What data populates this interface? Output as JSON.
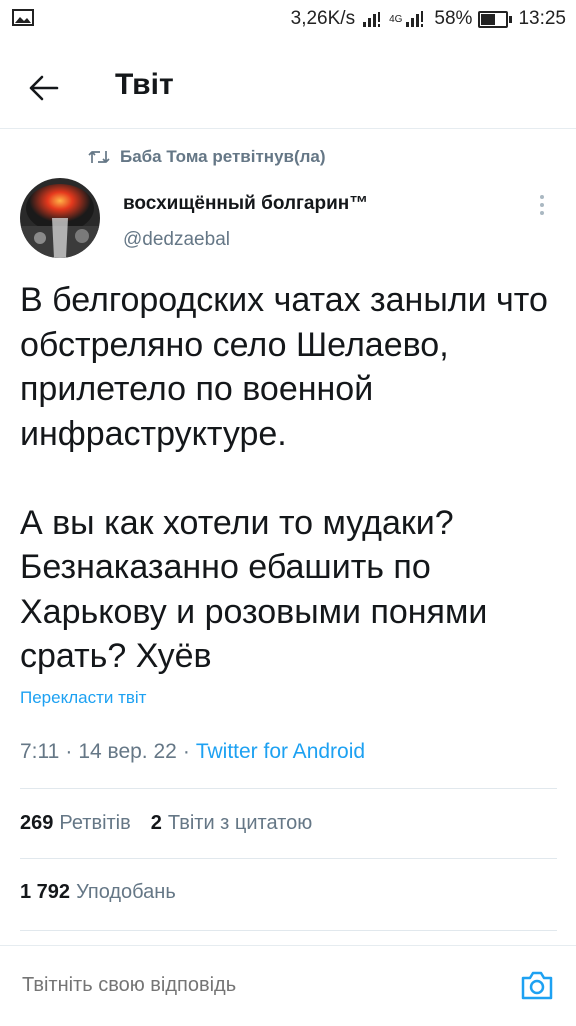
{
  "status_bar": {
    "net_speed": "3,26K/s",
    "network_type": "4G",
    "battery_percent": "58%",
    "battery_level": 0.58,
    "time": "13:25",
    "left_icon": "image-icon"
  },
  "header": {
    "back_icon": "arrow-left-icon",
    "title": "Твіт"
  },
  "tweet": {
    "retweet_context": "Баба Тома ретвітнув(ла)",
    "author_name": "восхищённый болгарин™",
    "author_handle": "@dedzaebal",
    "text": "В белгородских чатах заныли что обстреляно село Шелаево, прилетело по военной инфраструктуре.\n\nА вы как хотели то мудаки? Безнаказанно ебашить по Харькову и розовыми понями срать? Хуёв",
    "translate_label": "Перекласти твіт",
    "time": "7:11",
    "sep1": "·",
    "date": "14 вер. 22",
    "sep2": "·",
    "source": "Twitter for Android"
  },
  "stats": {
    "retweets_count": "269",
    "retweets_label": "Ретвітів",
    "quotes_count": "2",
    "quotes_label": "Твіти з цитатою",
    "likes_count": "1 792",
    "likes_label": "Уподобань"
  },
  "reply": {
    "placeholder": "Твітніть свою відповідь",
    "camera_icon": "camera-icon"
  },
  "colors": {
    "accent": "#1da1f2",
    "secondary_text": "#657786",
    "primary_text": "#14171a"
  }
}
